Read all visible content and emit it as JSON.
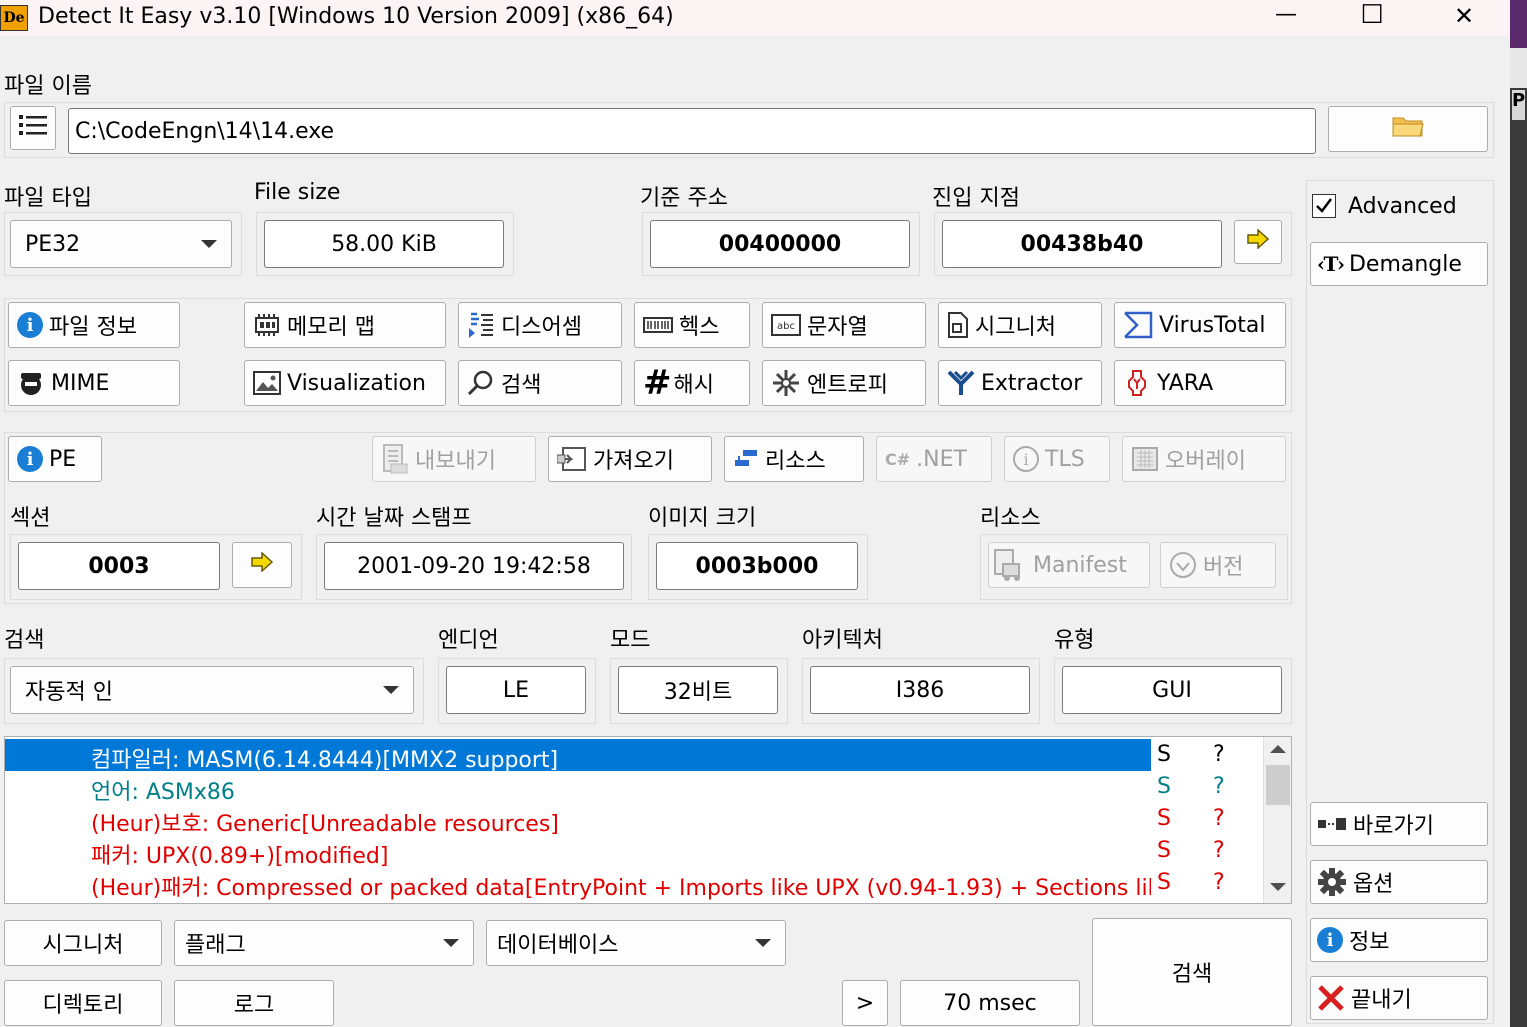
{
  "window": {
    "title": "Detect It Easy v3.10 [Windows 10 Version 2009] (x86_64)",
    "logo_text": "De",
    "minimize": "—",
    "maximize": "☐",
    "close": "✕"
  },
  "file": {
    "label": "파일 이름",
    "path": "C:\\CodeEngn\\14\\14.exe"
  },
  "info": {
    "file_type_label": "파일 타입",
    "file_type_value": "PE32",
    "file_size_label": "File size",
    "file_size_value": "58.00 KiB",
    "base_address_label": "기준 주소",
    "base_address_value": "00400000",
    "entry_point_label": "진입 지점",
    "entry_point_value": "00438b40"
  },
  "side": {
    "advanced_label": "Advanced",
    "advanced_checked": true,
    "demangle_label": "Demangle",
    "shortcut_label": "바로가기",
    "options_label": "옵션",
    "about_label": "정보",
    "exit_label": "끝내기"
  },
  "tools": {
    "file_info": "파일 정보",
    "memory_map": "메모리 맵",
    "disasm": "디스어셈",
    "hex": "헥스",
    "strings": "문자열",
    "signature": "시그니처",
    "virustotal": "VirusTotal",
    "mime": "MIME",
    "visualization": "Visualization",
    "search": "검색",
    "hash": "해시",
    "entropy": "엔트로피",
    "extractor": "Extractor",
    "yara": "YARA"
  },
  "pe": {
    "pe_label": "PE",
    "export": "내보내기",
    "import": "가져오기",
    "resources": "리소스",
    "dotnet": ".NET",
    "tls": "TLS",
    "overlay": "오버레이",
    "sections_label": "섹션",
    "sections_value": "0003",
    "timestamp_label": "시간 날짜 스탬프",
    "timestamp_value": "2001-09-20 19:42:58",
    "image_size_label": "이미지 크기",
    "image_size_value": "0003b000",
    "resources_label": "리소스",
    "manifest": "Manifest",
    "version": "버전"
  },
  "scan": {
    "scan_label": "검색",
    "scan_value": "자동적 인",
    "endian_label": "엔디언",
    "endian_value": "LE",
    "mode_label": "모드",
    "mode_value": "32비트",
    "arch_label": "아키텍처",
    "arch_value": "I386",
    "type_label": "유형",
    "type_value": "GUI"
  },
  "results": [
    {
      "text": "컴파일러: MASM(6.14.8444)[MMX2 support]",
      "s": "S",
      "q": "?",
      "color": "#ffffff",
      "selected": true
    },
    {
      "text": "언어: ASMx86",
      "s": "S",
      "q": "?",
      "color": "#00808a",
      "selected": false
    },
    {
      "text": "(Heur)보호: Generic[Unreadable resources]",
      "s": "S",
      "q": "?",
      "color": "#e00000",
      "selected": false
    },
    {
      "text": "패커: UPX(0.89+)[modified]",
      "s": "S",
      "q": "?",
      "color": "#e00000",
      "selected": false
    },
    {
      "text": "(Heur)패커: Compressed or packed data[EntryPoint + Imports like UPX (v0.94-1.93) + Sections like...",
      "s": "S",
      "q": "?",
      "color": "#e00000",
      "selected": false
    }
  ],
  "bottom": {
    "signatures": "시그니처",
    "flags": "플래그",
    "database": "데이터베이스",
    "directory": "디렉토리",
    "log": "로그",
    "more": ">",
    "time": "70 msec",
    "scan_button": "검색"
  },
  "colors": {
    "selection": "#0078d7",
    "info_icon": "#1a7fd4",
    "arrow_yellow": "#f5d800"
  }
}
